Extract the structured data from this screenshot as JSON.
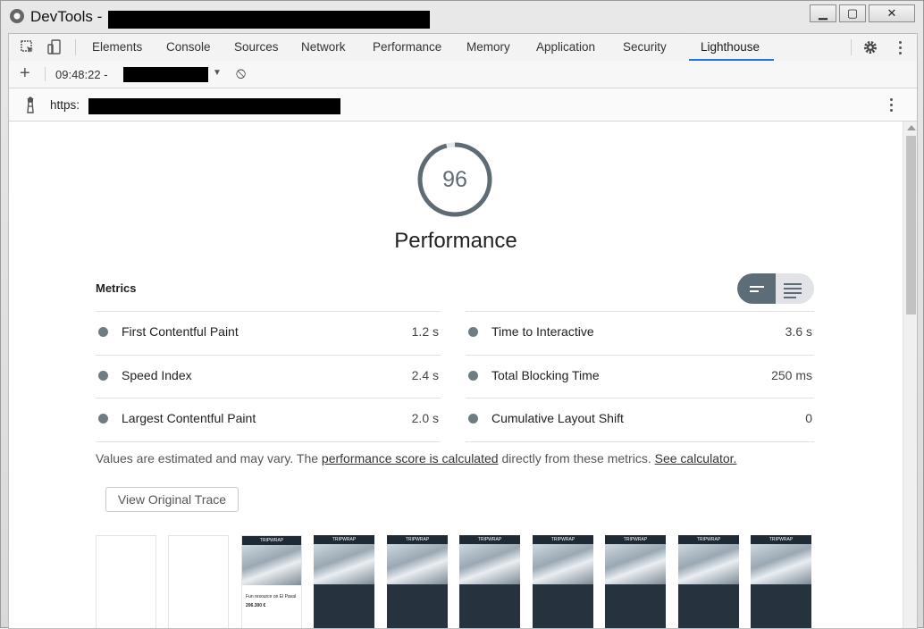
{
  "window": {
    "title": "DevTools -",
    "controls": [
      "▁",
      "▢",
      "✕"
    ]
  },
  "tabs": [
    "Elements",
    "Console",
    "Sources",
    "Network",
    "Performance",
    "Memory",
    "Application",
    "Security",
    "Lighthouse"
  ],
  "active_tab": "Lighthouse",
  "toolbar": {
    "add": "+",
    "report_time": "09:48:22 -",
    "dropdown_arrow": "▼",
    "block_icon": "⦸"
  },
  "url": {
    "prefix": "https:"
  },
  "report": {
    "score": "96",
    "score_fraction": 0.96,
    "category": "Performance",
    "metrics_title": "Metrics",
    "metrics": [
      {
        "label": "First Contentful Paint",
        "value": "1.2 s"
      },
      {
        "label": "Time to Interactive",
        "value": "3.6 s"
      },
      {
        "label": "Speed Index",
        "value": "2.4 s"
      },
      {
        "label": "Total Blocking Time",
        "value": "250 ms"
      },
      {
        "label": "Largest Contentful Paint",
        "value": "2.0 s"
      },
      {
        "label": "Cumulative Layout Shift",
        "value": "0"
      }
    ],
    "note": {
      "prefix": "Values are estimated and may vary. The ",
      "link1": "performance score is calculated",
      "middle": " directly from these metrics. ",
      "link2": "See calculator."
    },
    "trace_button": "View Original Trace",
    "filmstrip": {
      "frame_header": "TRIPWRAP",
      "frame_caption": "Fun resource on El Paval",
      "frame_price": "206.300 €"
    }
  },
  "colors": {
    "gauge": "#5f6b73",
    "active_tab_underline": "#1a73e8",
    "metric_dot": "#6f7c84"
  }
}
